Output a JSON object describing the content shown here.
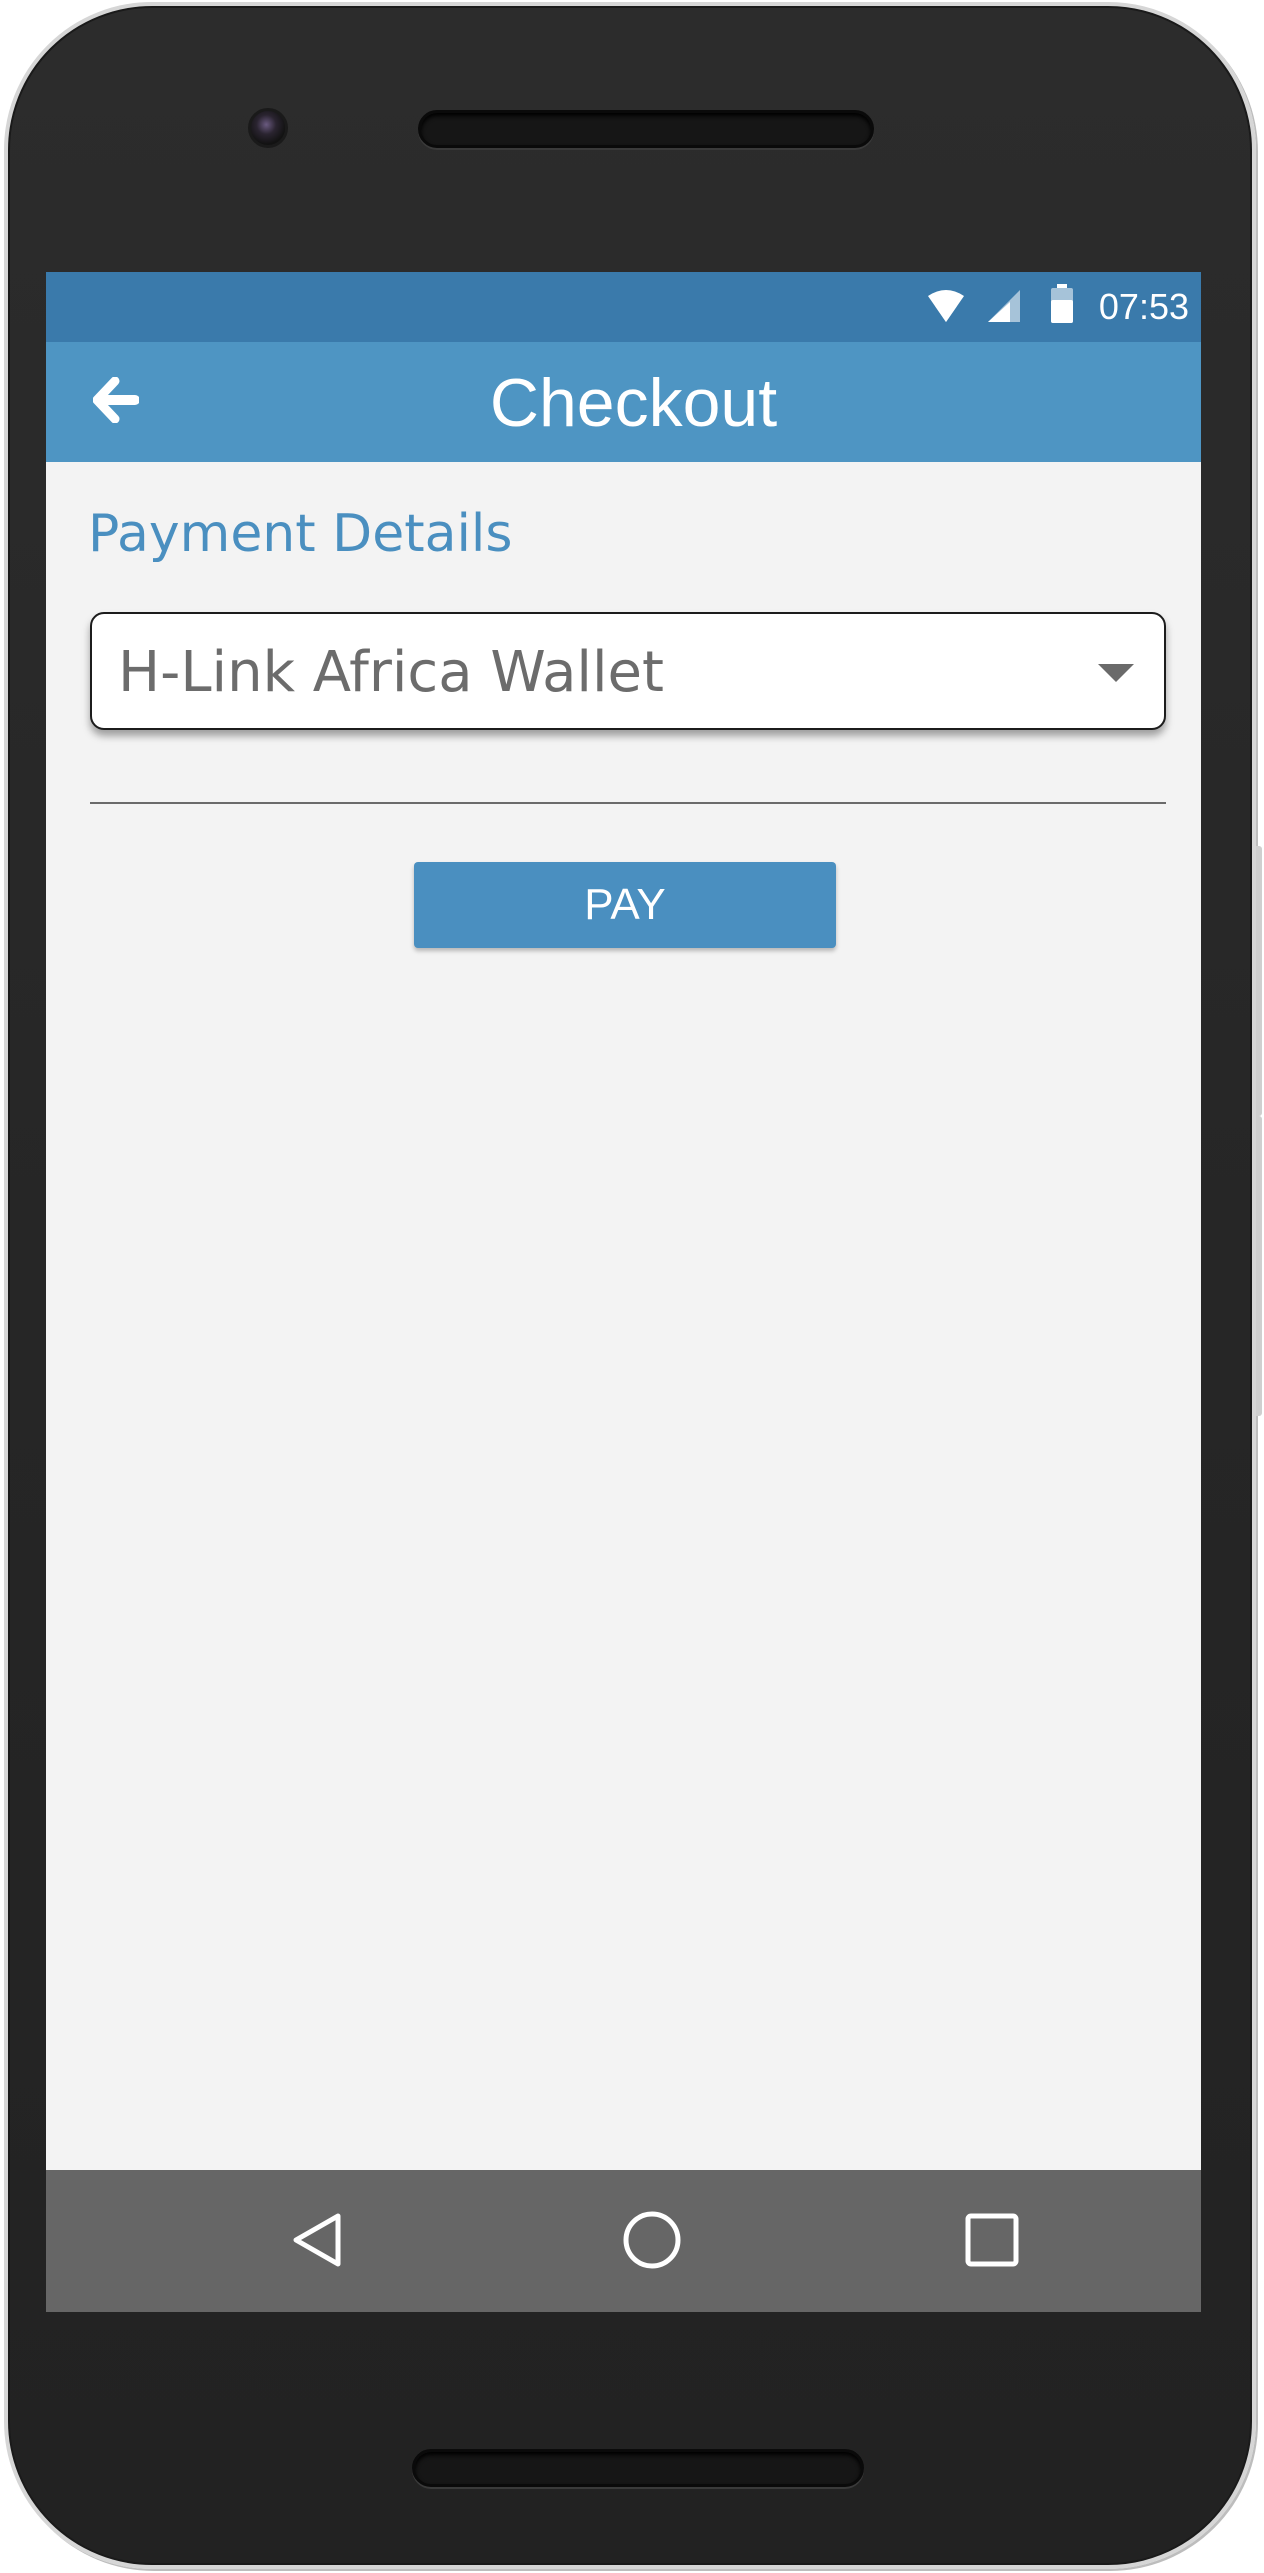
{
  "status_bar": {
    "time": "07:53",
    "icons": [
      "wifi-icon",
      "signal-icon",
      "battery-icon"
    ]
  },
  "toolbar": {
    "title": "Checkout",
    "back_icon": "arrow-left-icon"
  },
  "payment": {
    "section_title": "Payment Details",
    "method_selected": "H-Link Africa Wallet",
    "dropdown_icon": "caret-down-icon",
    "pay_label": "PAY"
  },
  "nav_bar": {
    "icons": [
      "back-triangle-icon",
      "home-circle-icon",
      "recents-square-icon"
    ]
  },
  "colors": {
    "status_bar": "#3a7aab",
    "toolbar": "#4e95c3",
    "accent": "#4a8fc0",
    "background": "#f3f3f3",
    "nav_bar": "#666666"
  }
}
